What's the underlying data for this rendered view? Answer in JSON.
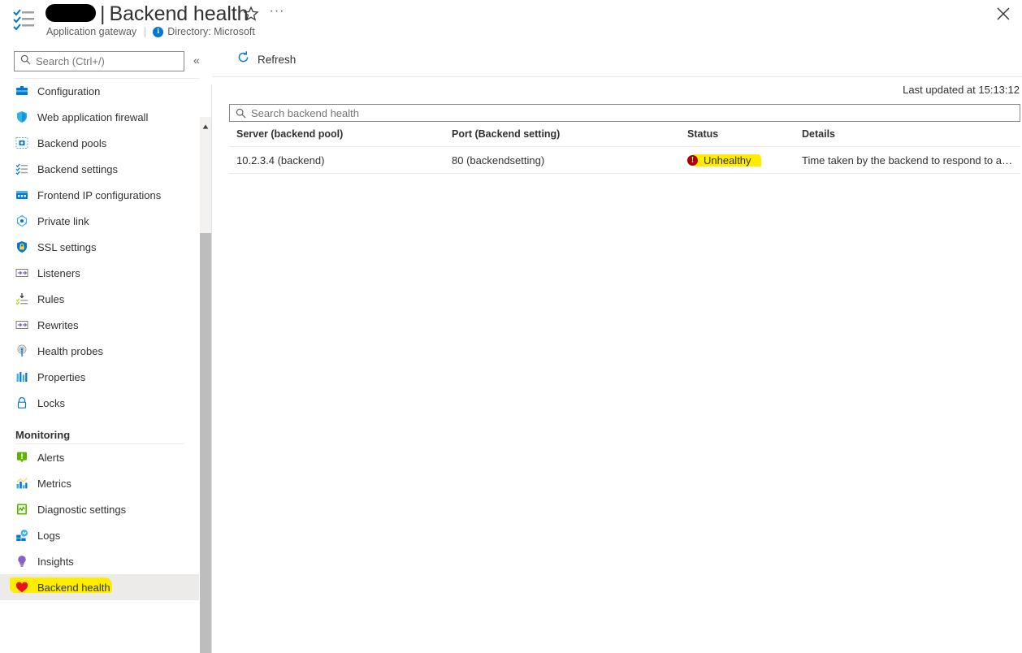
{
  "header": {
    "resource_name_redacted": "",
    "separator": "|",
    "title": "Backend health",
    "service_type": "Application gateway",
    "directory": "Directory: Microsoft",
    "info_glyph": "i",
    "star_icon": "favorite-star-icon",
    "ellipsis": "···",
    "close_icon": "close-icon"
  },
  "sidebar": {
    "search": {
      "placeholder": "Search (Ctrl+/)",
      "value": ""
    },
    "collapse_glyph": "«",
    "items": [
      {
        "label": "Configuration",
        "icon": "configuration-icon",
        "selected": false,
        "highlighted": false
      },
      {
        "label": "Web application firewall",
        "icon": "shield-icon",
        "selected": false,
        "highlighted": false
      },
      {
        "label": "Backend pools",
        "icon": "backend-pools-icon",
        "selected": false,
        "highlighted": false
      },
      {
        "label": "Backend settings",
        "icon": "backend-settings-icon",
        "selected": false,
        "highlighted": false
      },
      {
        "label": "Frontend IP configurations",
        "icon": "frontend-ip-icon",
        "selected": false,
        "highlighted": false
      },
      {
        "label": "Private link",
        "icon": "private-link-icon",
        "selected": false,
        "highlighted": false
      },
      {
        "label": "SSL settings",
        "icon": "ssl-lock-icon",
        "selected": false,
        "highlighted": false
      },
      {
        "label": "Listeners",
        "icon": "listeners-icon",
        "selected": false,
        "highlighted": false
      },
      {
        "label": "Rules",
        "icon": "rules-icon",
        "selected": false,
        "highlighted": false
      },
      {
        "label": "Rewrites",
        "icon": "rewrites-icon",
        "selected": false,
        "highlighted": false
      },
      {
        "label": "Health probes",
        "icon": "health-probes-icon",
        "selected": false,
        "highlighted": false
      },
      {
        "label": "Properties",
        "icon": "properties-icon",
        "selected": false,
        "highlighted": false
      },
      {
        "label": "Locks",
        "icon": "lock-icon",
        "selected": false,
        "highlighted": false
      }
    ],
    "group_label": "Monitoring",
    "monitoring_items": [
      {
        "label": "Alerts",
        "icon": "alerts-icon",
        "selected": false,
        "highlighted": false
      },
      {
        "label": "Metrics",
        "icon": "metrics-icon",
        "selected": false,
        "highlighted": false
      },
      {
        "label": "Diagnostic settings",
        "icon": "diagnostic-settings-icon",
        "selected": false,
        "highlighted": false
      },
      {
        "label": "Logs",
        "icon": "logs-icon",
        "selected": false,
        "highlighted": false
      },
      {
        "label": "Insights",
        "icon": "insights-bulb-icon",
        "selected": false,
        "highlighted": false
      },
      {
        "label": "Backend health",
        "icon": "heart-icon",
        "selected": true,
        "highlighted": true
      }
    ]
  },
  "toolbar": {
    "refresh_label": "Refresh",
    "refresh_icon": "refresh-icon"
  },
  "main": {
    "last_updated": "Last updated at 15:13:12",
    "search": {
      "placeholder": "Search backend health",
      "value": ""
    },
    "table": {
      "columns": [
        "Server (backend pool)",
        "Port (Backend setting)",
        "Status",
        "Details"
      ],
      "rows": [
        {
          "server": "10.2.3.4 (backend)",
          "port": "80 (backendsetting)",
          "status": "Unhealthy",
          "status_icon": "error-icon",
          "status_highlighted": true,
          "details": "Time taken by the backend to respond to a…"
        }
      ]
    }
  },
  "colors": {
    "accent": "#0078d4",
    "error": "#a80000",
    "highlight": "#ffed00",
    "selected_row": "#edebe9",
    "text": "#323130",
    "muted_text": "#605e5c",
    "divider": "#edebe9"
  }
}
